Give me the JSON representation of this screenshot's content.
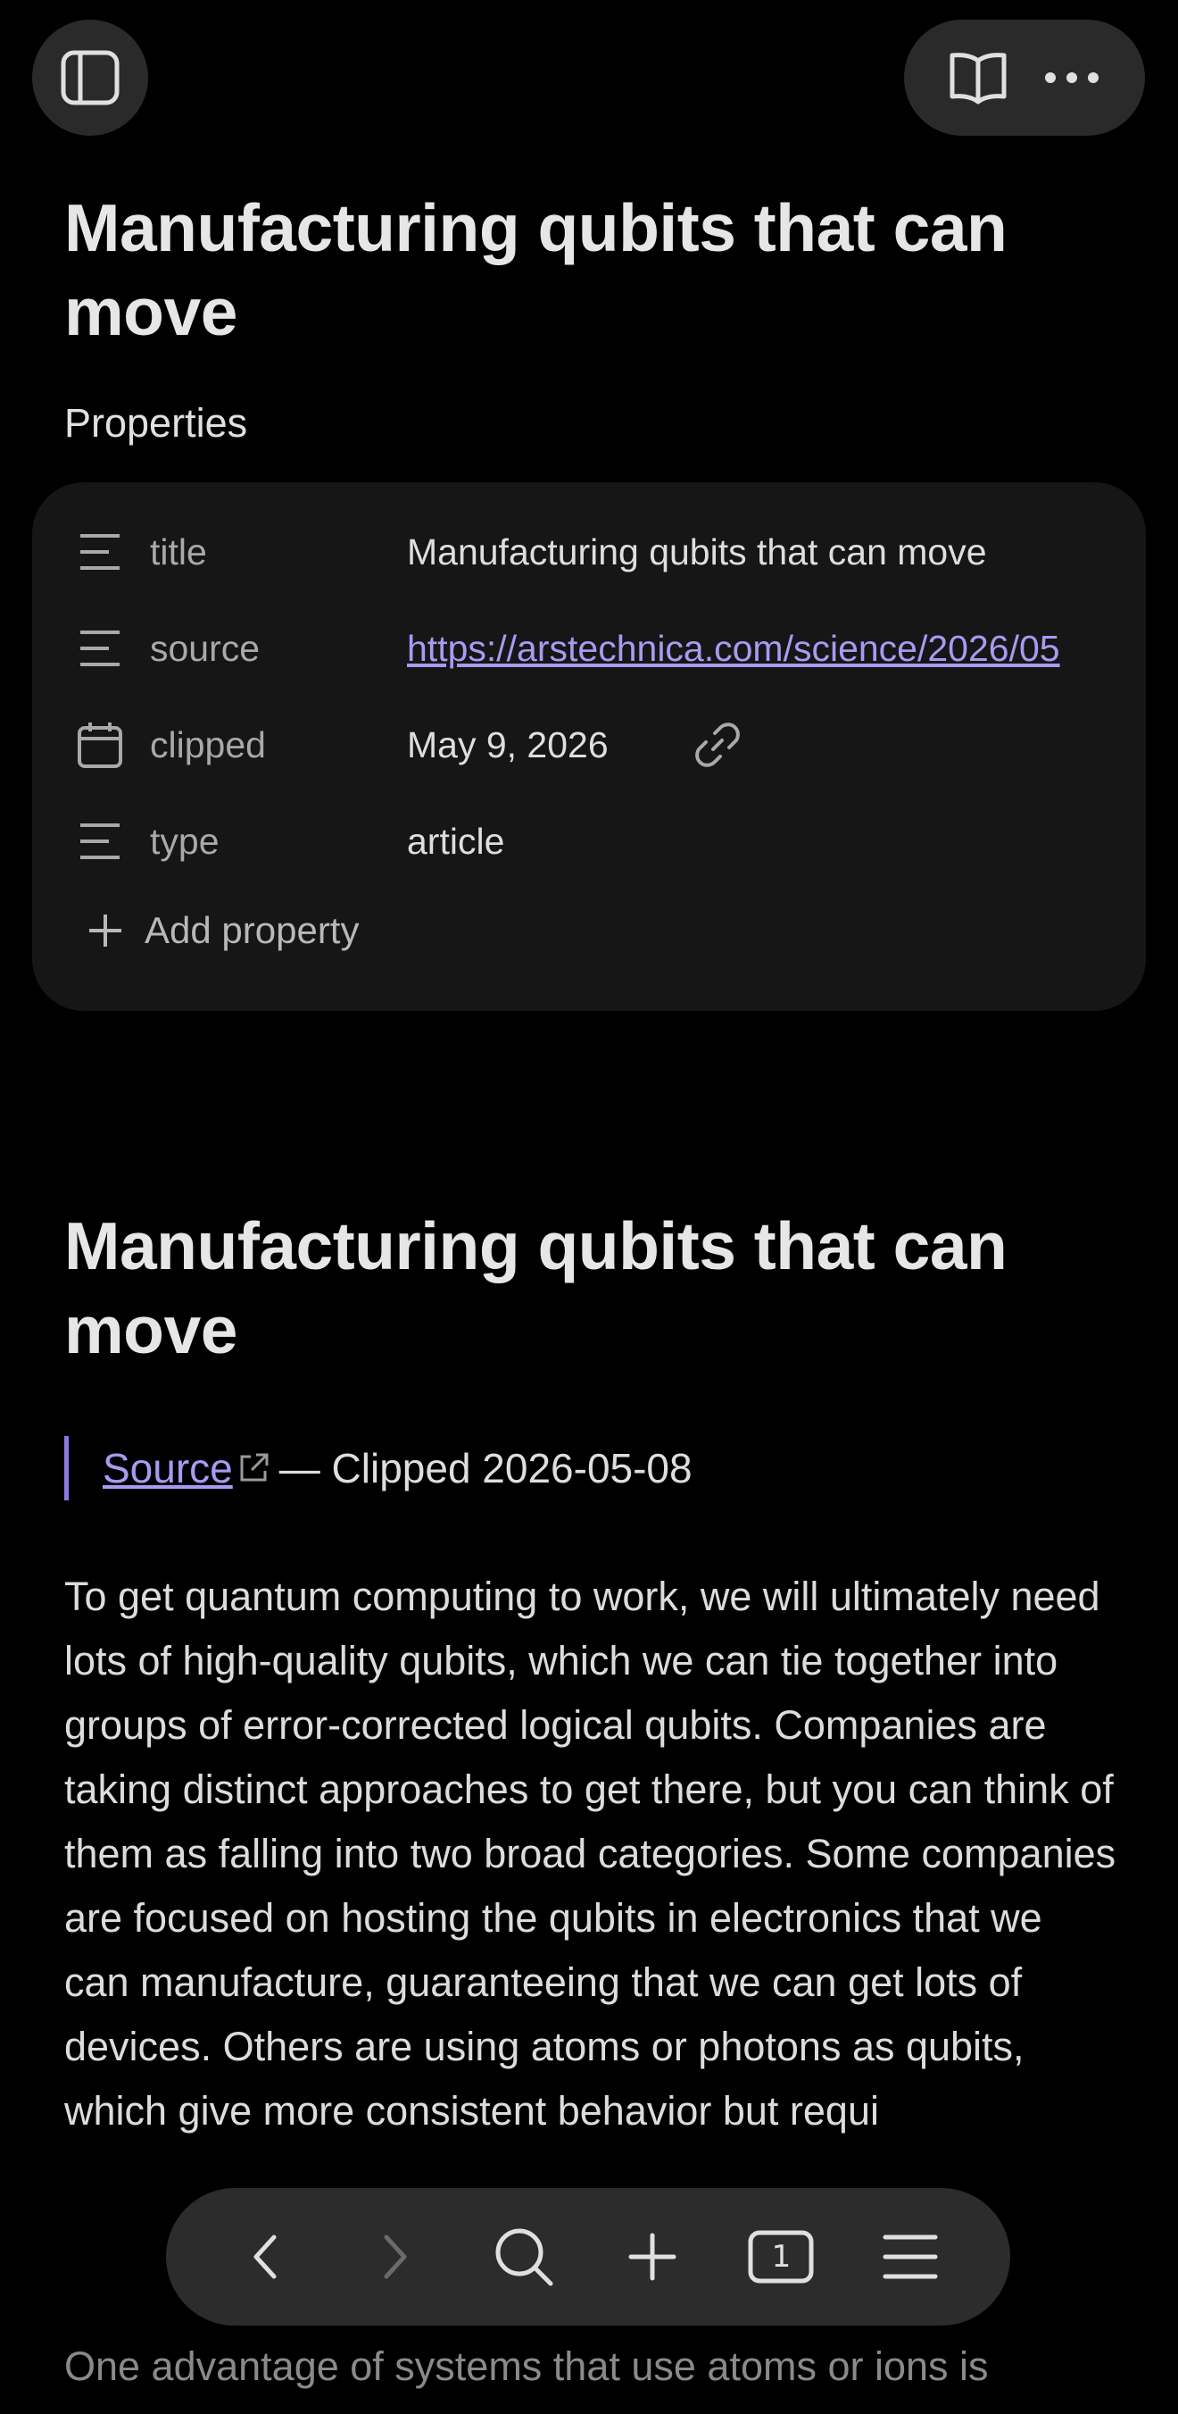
{
  "header": {
    "sidebar_icon": "sidebar-toggle-icon",
    "reader_icon": "book-open-icon",
    "more_icon": "more-horizontal-icon"
  },
  "note": {
    "title": "Manufacturing qubits that can move",
    "properties_label": "Properties",
    "properties": [
      {
        "icon": "text-lines-icon",
        "key": "title",
        "value": "Manufacturing qubits that can move"
      },
      {
        "icon": "text-lines-icon",
        "key": "source",
        "value": "https://arstechnica.com/science/2026/05"
      },
      {
        "icon": "calendar-icon",
        "key": "clipped",
        "value": "May 9, 2026"
      },
      {
        "icon": "text-lines-icon",
        "key": "type",
        "value": "article"
      }
    ],
    "add_property_label": "Add property"
  },
  "body": {
    "heading": "Manufacturing qubits that can move",
    "source_link": "Source",
    "clipped_text": "— Clipped 2026-05-08",
    "paragraph_1": "To get quantum computing to work, we will ultimately need lots of high-quality qubits, which we can tie together into groups of error-corrected logical qubits. Companies are taking distinct approaches to get there, but you can think of them as falling into two broad categories. Some companies are focused on hosting the qubits in electronics that we can manufacture, guaranteeing that we can get lots of devices. Others are using atoms or photons as qubits, which give more consistent behavior but requi",
    "paragraph_2": "One advantage of systems that use atoms or ions is"
  },
  "toolbar": {
    "back_icon": "chevron-left-icon",
    "forward_icon": "chevron-right-icon",
    "search_icon": "search-icon",
    "new_icon": "plus-icon",
    "tab_count": "1",
    "menu_icon": "menu-icon"
  },
  "colors": {
    "accent": "#a99af0",
    "background": "#000000",
    "card": "#161616"
  }
}
